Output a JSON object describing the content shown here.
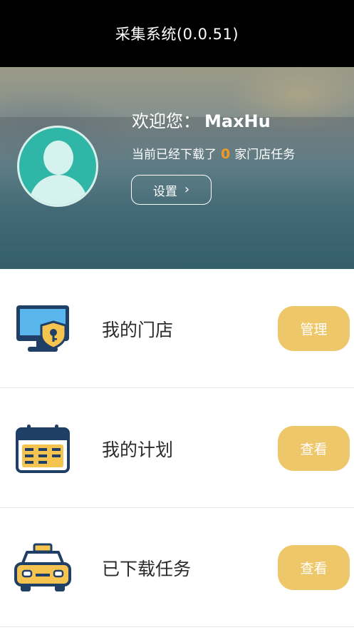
{
  "app": {
    "title": "采集系统(0.0.51)"
  },
  "profile": {
    "welcome_prefix": "欢迎您：",
    "username": "MaxHu",
    "download_prefix": "当前已经下载了",
    "download_count": "0",
    "download_suffix": "家门店任务",
    "settings_label": "设置",
    "settings_chevron": "›"
  },
  "menu": {
    "items": [
      {
        "label": "我的门店",
        "action": "管理",
        "icon": "monitor-shield-icon"
      },
      {
        "label": "我的计划",
        "action": "查看",
        "icon": "calendar-icon"
      },
      {
        "label": "已下载任务",
        "action": "查看",
        "icon": "taxi-icon"
      }
    ]
  },
  "colors": {
    "titlebar_bg": "#000000",
    "accent_orange": "#f39a1e",
    "action_button": "#efc76b",
    "icon_navy": "#1f3f66",
    "icon_yellow": "#f5c34f",
    "avatar_teal": "#2fb6a6"
  }
}
